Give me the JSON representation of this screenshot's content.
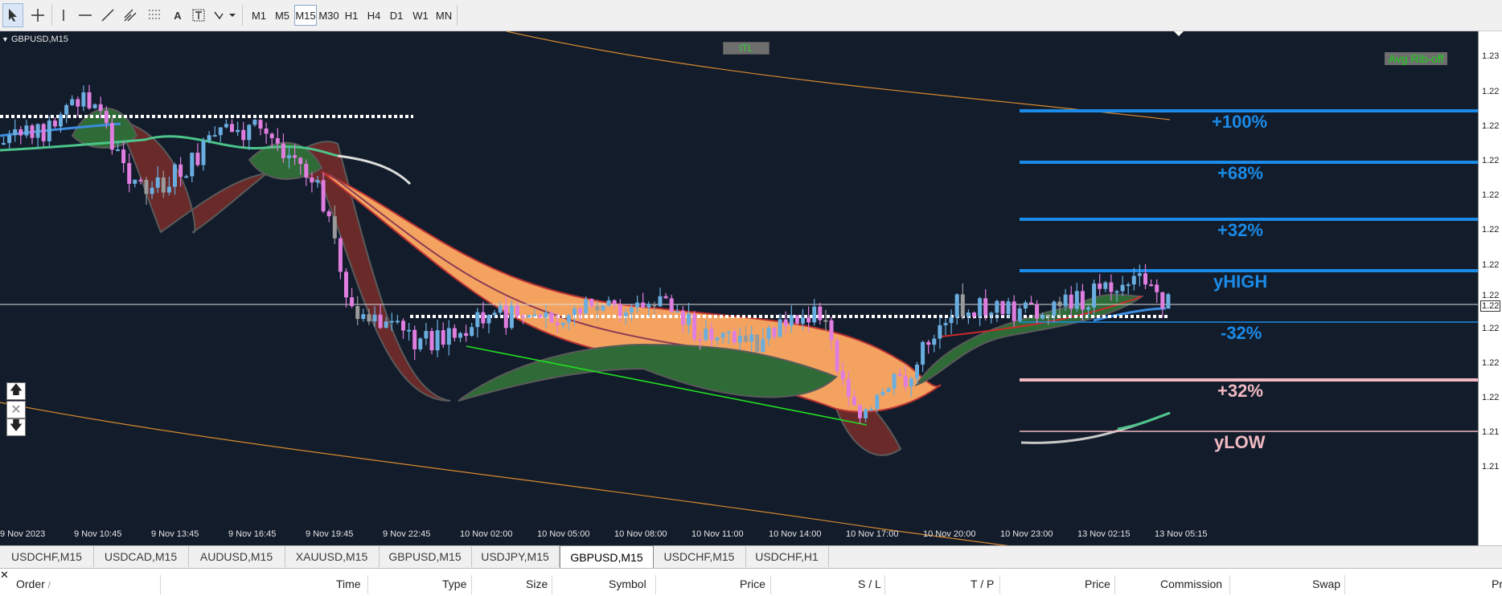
{
  "toolbar": {
    "timeframes": [
      "M1",
      "M5",
      "M15",
      "M30",
      "H1",
      "H4",
      "D1",
      "W1",
      "MN"
    ],
    "active_timeframe": "M15"
  },
  "chart": {
    "symbol_label": "GBPUSD,M15",
    "itl_label": "ITL",
    "avg_rib_label": "Avg Rib-off",
    "levels": [
      "+100%",
      "+68%",
      "+32%",
      "yHIGH",
      "-32%",
      "+32%",
      "yLOW"
    ],
    "time_labels": [
      "9 Nov 2023",
      "9 Nov 10:45",
      "9 Nov 13:45",
      "9 Nov 16:45",
      "9 Nov 19:45",
      "9 Nov 22:45",
      "10 Nov 02:00",
      "10 Nov 05:00",
      "10 Nov 08:00",
      "10 Nov 11:00",
      "10 Nov 14:00",
      "10 Nov 17:00",
      "10 Nov 20:00",
      "10 Nov 23:00",
      "13 Nov 02:15",
      "13 Nov 05:15"
    ],
    "price_labels": [
      "1.23",
      "1.22",
      "1.22",
      "1.22",
      "1.22",
      "1.22",
      "1.22",
      "1.22",
      "1.22",
      "1.22",
      "1.22",
      "1.21",
      "1.21"
    ],
    "current_price_label": "1.22",
    "colors": {
      "background": "#131c2b",
      "bull": "#6aaee0",
      "bear": "#e07ee0",
      "orange_band": "#f3a35f",
      "green_band": "#2f6b36",
      "maroon_band": "#6b2a2a",
      "level_blue": "#1a8be8",
      "level_pink": "#f1b9c2"
    }
  },
  "tabs": [
    "USDCHF,M15",
    "USDCAD,M15",
    "AUDUSD,M15",
    "XAUUSD,M15",
    "GBPUSD,M15",
    "USDJPY,M15",
    "GBPUSD,M15",
    "USDCHF,M15",
    "USDCHF,H1"
  ],
  "active_tab_index": 6,
  "terminal": {
    "columns": [
      "Order",
      "Time",
      "Type",
      "Size",
      "Symbol",
      "Price",
      "S / L",
      "T / P",
      "Price",
      "Commission",
      "Swap",
      "Pr"
    ]
  }
}
